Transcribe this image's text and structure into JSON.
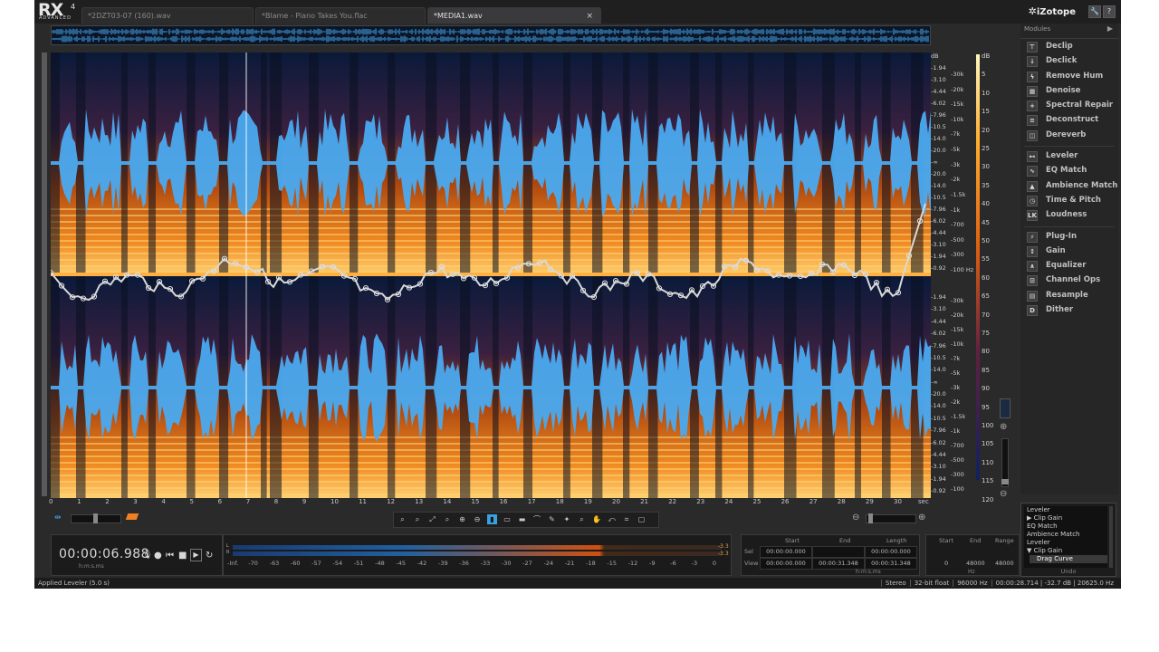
{
  "app": {
    "logo": "RX",
    "logo_version": "4",
    "logo_edition": "ADVANCED",
    "brand": "iZotope"
  },
  "tabs": [
    {
      "label": "*2DZT03-07 (160).wav"
    },
    {
      "label": "*Blame - Piano Takes You.flac"
    },
    {
      "label": "*MEDIA1.wav",
      "close": "×"
    }
  ],
  "header_buttons": {
    "settings": "🔧",
    "help": "?"
  },
  "time_axis": [
    "0",
    "1",
    "2",
    "3",
    "4",
    "5",
    "6",
    "7",
    "8",
    "9",
    "10",
    "11",
    "12",
    "13",
    "14",
    "15",
    "16",
    "17",
    "18",
    "19",
    "20",
    "21",
    "22",
    "23",
    "24",
    "25",
    "26",
    "27",
    "28",
    "29",
    "30",
    "sec"
  ],
  "db_axis_top": [
    "dB",
    "-1.94",
    "-3.10",
    "-4.44",
    "-6.02",
    "-7.96",
    "-10.5",
    "-14.0",
    "-20.0",
    "-∞",
    "-20.0",
    "-14.0",
    "-10.5",
    "-7.96",
    "-6.02",
    "-4.44",
    "-3.10",
    "-1.94",
    "-0.92"
  ],
  "hz_axis_top": [
    "-30k",
    "-20k",
    "-15k",
    "-10k",
    "-7k",
    "-5k",
    "-3k",
    "-2k",
    "-1.5k",
    "-1k",
    "-700",
    "-500",
    "-300",
    "-100 Hz"
  ],
  "db_axis_bottom": [
    "-1.94",
    "-3.10",
    "-4.44",
    "-6.02",
    "-7.96",
    "-10.5",
    "-14.0",
    "-∞",
    "-20.0",
    "-14.0",
    "-10.5",
    "-7.96",
    "-6.02",
    "-4.44",
    "-3.10",
    "-1.94",
    "-0.92"
  ],
  "hz_axis_bottom": [
    "-30k",
    "-20k",
    "-15k",
    "-10k",
    "-7k",
    "-5k",
    "-3k",
    "-2k",
    "-1.5k",
    "-1k",
    "-700",
    "-500",
    "-300",
    "-100"
  ],
  "right_scale": [
    "dB",
    "5",
    "10",
    "15",
    "20",
    "25",
    "30",
    "35",
    "40",
    "45",
    "50",
    "55",
    "60",
    "65",
    "70",
    "75",
    "80",
    "85",
    "90",
    "95",
    "100",
    "105",
    "110",
    "115",
    "120"
  ],
  "modules": {
    "title": "Modules",
    "groups": [
      [
        {
          "label": "Declip",
          "icon": "⊤"
        },
        {
          "label": "Declick",
          "icon": "↓"
        },
        {
          "label": "Remove Hum",
          "icon": "ϟ"
        },
        {
          "label": "Denoise",
          "icon": "▦"
        },
        {
          "label": "Spectral Repair",
          "icon": "+"
        },
        {
          "label": "Deconstruct",
          "icon": "≡"
        },
        {
          "label": "Dereverb",
          "icon": "◫"
        }
      ],
      [
        {
          "label": "Leveler",
          "icon": "⊷"
        },
        {
          "label": "EQ Match",
          "icon": "∿"
        },
        {
          "label": "Ambience Match",
          "icon": "▲"
        },
        {
          "label": "Time & Pitch",
          "icon": "◷"
        },
        {
          "label": "Loudness",
          "icon": "LK"
        }
      ],
      [
        {
          "label": "Plug-In",
          "icon": "⚡"
        },
        {
          "label": "Gain",
          "icon": "↕"
        },
        {
          "label": "Equalizer",
          "icon": "∧"
        },
        {
          "label": "Channel Ops",
          "icon": "⊡"
        },
        {
          "label": "Resample",
          "icon": "▤"
        },
        {
          "label": "Dither",
          "icon": "D"
        }
      ]
    ]
  },
  "undo": {
    "items": [
      "Leveler",
      "▶ Clip Gain",
      "EQ Match",
      "Ambience Match",
      "Leveler",
      "▼ Clip Gain"
    ],
    "selected": "Drag Curve",
    "label": "Undo"
  },
  "transport": {
    "timecode": "00:00:06.988",
    "unit": "h:m:s.ms"
  },
  "meter": {
    "peak_l": "-3.3",
    "peak_r": "-3.3",
    "scale": [
      "-Inf.",
      "-70",
      "-63",
      "-60",
      "-57",
      "-54",
      "-51",
      "-48",
      "-45",
      "-42",
      "-39",
      "-36",
      "-33",
      "-30",
      "-27",
      "-24",
      "-21",
      "-18",
      "-15",
      "-12",
      "-9",
      "-6",
      "-3",
      "0"
    ]
  },
  "selection": {
    "headers": [
      "Start",
      "End",
      "Length"
    ],
    "rows": [
      {
        "label": "Sel",
        "start": "00:00:00.000",
        "end": "",
        "length": "00:00:00.000"
      },
      {
        "label": "View",
        "start": "00:00:00.000",
        "end": "00:00:31.348",
        "length": "00:00:31.348"
      }
    ],
    "unit": "h:m:s.ms"
  },
  "freq": {
    "headers": [
      "Start",
      "End",
      "Range"
    ],
    "values": [
      "0",
      "48000",
      "48000"
    ],
    "unit": "Hz"
  },
  "status": {
    "left": "Applied Leveler (5.0 s)",
    "right": [
      "Stereo",
      "32-bit float",
      "96000 Hz",
      "00:00:28.714 | -32.7 dB | 20625.0 Hz"
    ]
  },
  "colors": {
    "accent": "#3aa0e0",
    "spectro_hot": "#f08020",
    "bg": "#2a2a2b"
  }
}
